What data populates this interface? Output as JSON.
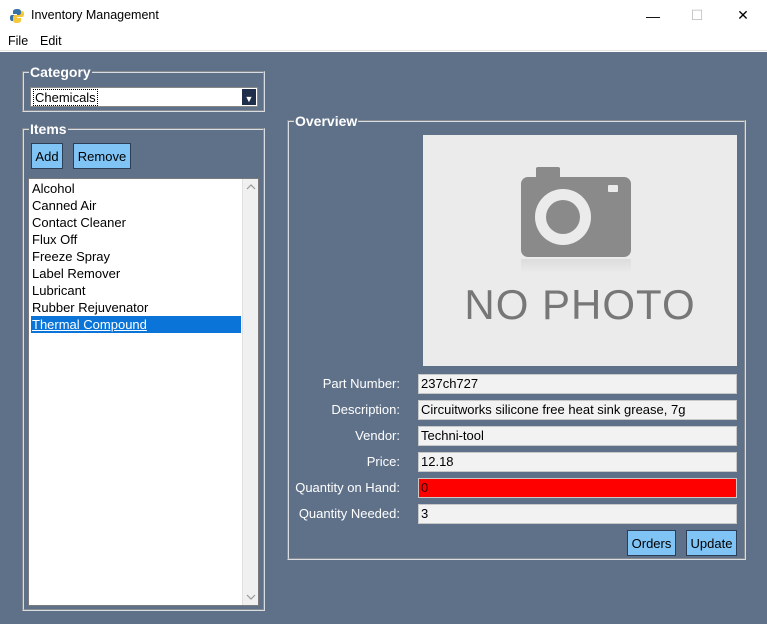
{
  "window": {
    "title": "Inventory Management",
    "minimize_glyph": "—",
    "maximize_glyph": "☐",
    "close_glyph": "✕"
  },
  "menu": {
    "file": "File",
    "edit": "Edit"
  },
  "category": {
    "label": "Category",
    "selected": "Chemicals",
    "dropdown_glyph": "▼"
  },
  "items": {
    "label": "Items",
    "add_label": "Add",
    "remove_label": "Remove",
    "list": [
      "Alcohol",
      "Canned Air",
      "Contact Cleaner",
      "Flux Off",
      "Freeze Spray",
      "Label Remover",
      "Lubricant",
      "Rubber Rejuvenator",
      "Thermal Compound"
    ],
    "selected_index": 8
  },
  "overview": {
    "label": "Overview",
    "photo_text": "NO PHOTO",
    "fields": {
      "part_number": {
        "label": "Part Number:",
        "value": "237ch727"
      },
      "description": {
        "label": "Description:",
        "value": "Circuitworks silicone free heat sink grease, 7g"
      },
      "vendor": {
        "label": "Vendor:",
        "value": "Techni-tool"
      },
      "price": {
        "label": "Price:",
        "value": "12.18"
      },
      "quantity_on_hand": {
        "label": "Quantity on Hand:",
        "value": "0"
      },
      "quantity_needed": {
        "label": "Quantity Needed:",
        "value": "3"
      }
    },
    "orders_label": "Orders",
    "update_label": "Update"
  },
  "colors": {
    "window_bg": "#5f7189",
    "button_bg": "#7fc4f5",
    "selection": "#0a74d9",
    "alert": "#ff0000"
  }
}
